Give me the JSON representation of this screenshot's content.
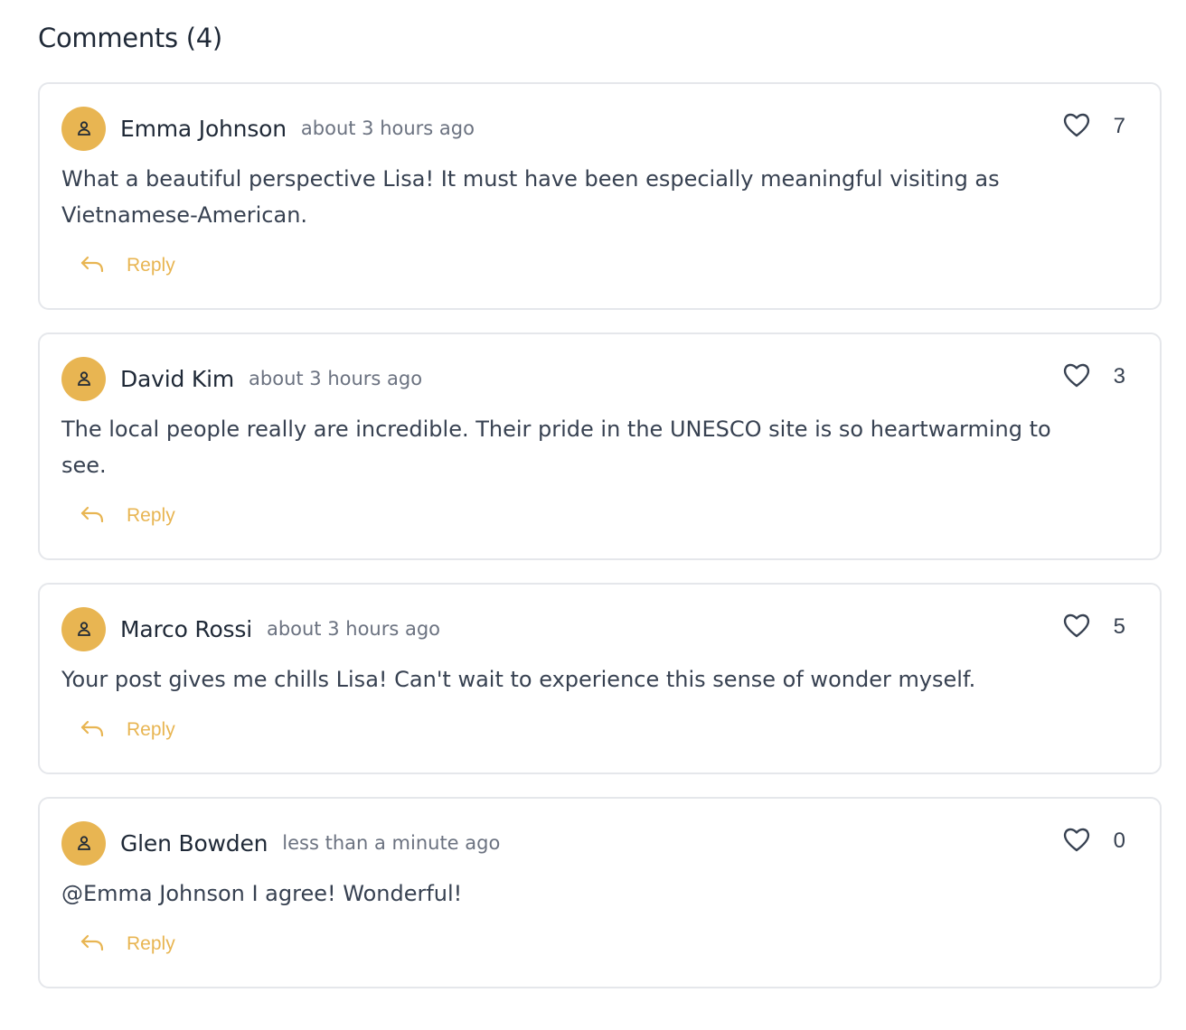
{
  "section": {
    "title": "Comments (4)"
  },
  "colors": {
    "accent": "#e8b552",
    "border": "#e5e7eb",
    "muted": "#6b7280",
    "text": "#374151"
  },
  "icons": {
    "avatar": "user-icon",
    "like": "heart-icon",
    "reply": "reply-arrow-icon"
  },
  "comments": [
    {
      "author": "Emma Johnson",
      "time": "about 3 hours ago",
      "likes": "7",
      "text": "What a beautiful perspective Lisa! It must have been especially meaningful visiting as Vietnamese-American.",
      "reply_label": "Reply"
    },
    {
      "author": "David Kim",
      "time": "about 3 hours ago",
      "likes": "3",
      "text": "The local people really are incredible. Their pride in the UNESCO site is so heartwarming to see.",
      "reply_label": "Reply"
    },
    {
      "author": "Marco Rossi",
      "time": "about 3 hours ago",
      "likes": "5",
      "text": "Your post gives me chills Lisa! Can't wait to experience this sense of wonder myself.",
      "reply_label": "Reply"
    },
    {
      "author": "Glen Bowden",
      "time": "less than a minute ago",
      "likes": "0",
      "text": "@Emma Johnson I agree! Wonderful!",
      "reply_label": "Reply"
    }
  ]
}
